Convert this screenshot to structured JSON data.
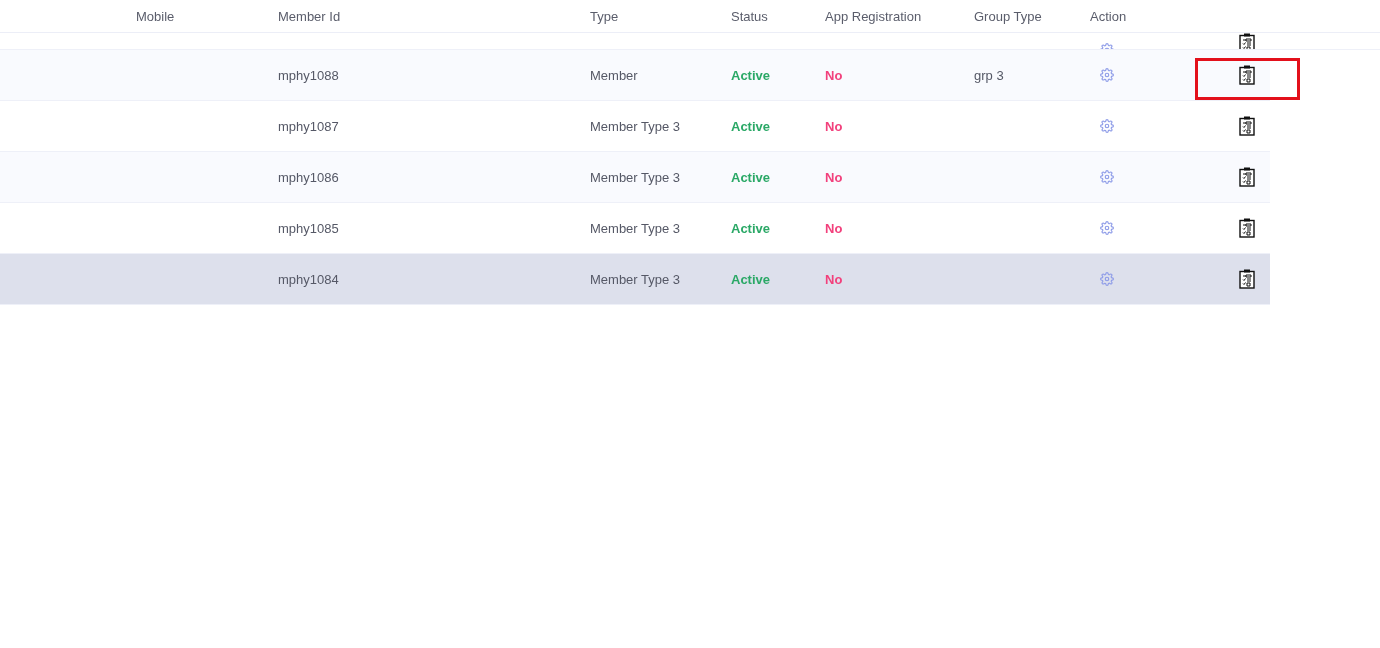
{
  "table": {
    "columns": [
      "Mobile",
      "Member Id",
      "Type",
      "Status",
      "App Registration",
      "Group Type",
      "Action"
    ],
    "rows": [
      {
        "member_id": "mphy1088",
        "type": "Member",
        "status": "Active",
        "app_registration": "No",
        "group_type": "grp 3",
        "selected": false,
        "outlined": true
      },
      {
        "member_id": "mphy1087",
        "type": "Member Type 3",
        "status": "Active",
        "app_registration": "No",
        "selected": false,
        "outlined": false
      },
      {
        "member_id": "mphy1086",
        "type": "Member Type 3",
        "status": "Active",
        "app_registration": "No",
        "selected": false,
        "outlined": false
      },
      {
        "member_id": "mphy1085",
        "type": "Member Type 3",
        "status": "Active",
        "app_registration": "No",
        "selected": false,
        "outlined": false
      },
      {
        "member_id": "mphy1084",
        "type": "Member Type 3",
        "status": "Active",
        "app_registration": "No",
        "selected": true,
        "outlined": false
      }
    ]
  }
}
